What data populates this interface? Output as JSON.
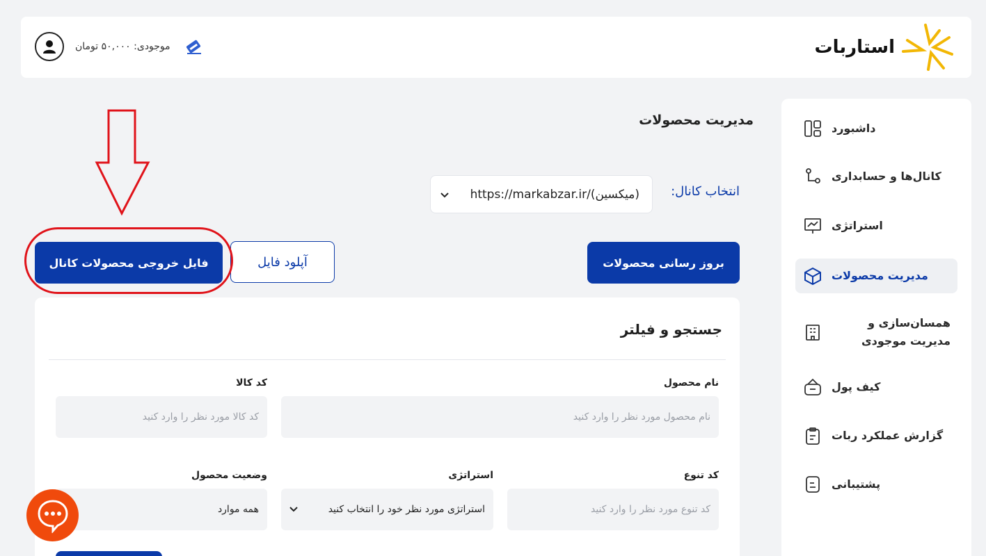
{
  "header": {
    "logo_text": "استاربات",
    "balance": "موجودی: ۵۰,۰۰۰ تومان",
    "colors": {
      "logo_star": "#f2b705"
    }
  },
  "sidebar": {
    "items": [
      {
        "label": "داشبورد",
        "icon": "dashboard-icon"
      },
      {
        "label": "کانال‌ها و حسابداری",
        "icon": "channels-icon"
      },
      {
        "label": "استراتژی",
        "icon": "strategy-icon"
      },
      {
        "label": "مدیریت محصولات",
        "icon": "box-icon",
        "active": true
      },
      {
        "label": "همسان‌سازی و مدیریت موجودی",
        "icon": "inventory-icon"
      },
      {
        "label": "کیف پول",
        "icon": "wallet-icon"
      },
      {
        "label": "گزارش عملکرد ربات",
        "icon": "report-icon"
      },
      {
        "label": "پشتیبانی",
        "icon": "support-icon"
      }
    ]
  },
  "main": {
    "title": "مدیریت محصولات",
    "channel_label": "انتخاب کانال:",
    "channel_value": "https://markabzar.ir/(میکسین)",
    "buttons": {
      "update_products": "بروز رسانی محصولات",
      "upload_file": "آپلود فایل",
      "export_file": "فایل خروجی محصولات کانال"
    }
  },
  "filter": {
    "title": "جستجو و فیلتر",
    "product_name_label": "نام محصول",
    "product_name_placeholder": "نام محصول مورد نظر را وارد کنید",
    "product_code_label": "کد کالا",
    "product_code_placeholder": "کد کالا مورد نظر را وارد کنید",
    "variant_code_label": "کد تنوع",
    "variant_code_placeholder": "کد تنوع مورد نظر را وارد کنید",
    "strategy_label": "استراتژی",
    "strategy_value": "استراتژی مورد نظر خود را انتخاب کنید",
    "status_label": "وضعیت محصول",
    "status_value": "همه موارد"
  },
  "colors": {
    "primary": "#0b3aa8",
    "annotation_red": "#e0131a",
    "chat_orange": "#f04a0c"
  }
}
